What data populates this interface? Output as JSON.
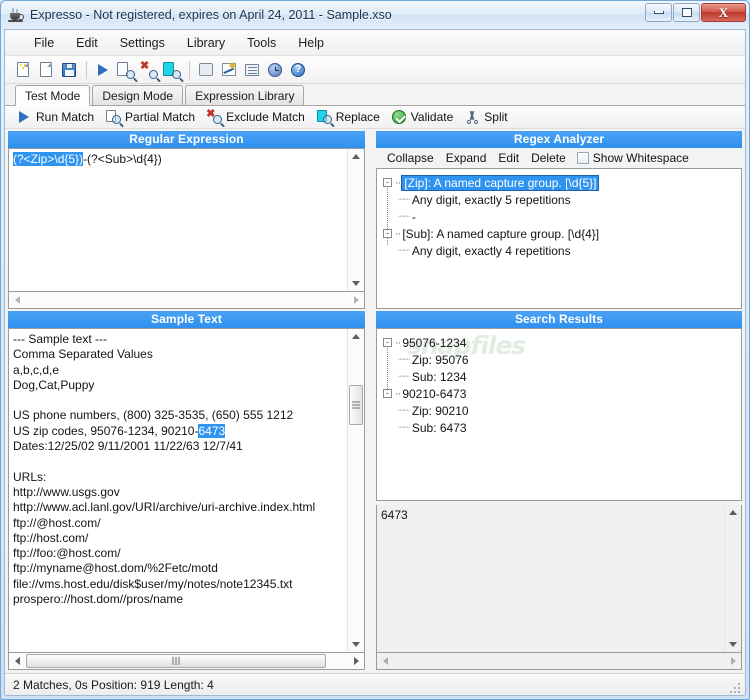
{
  "window": {
    "title": "Expresso - Not registered, expires on April 24, 2011 - Sample.xso",
    "icon": "coffee-cup-icon",
    "minimize_label": "–",
    "maximize_label": "□",
    "close_label": "X"
  },
  "menubar": {
    "items": [
      {
        "label": "File"
      },
      {
        "label": "Edit"
      },
      {
        "label": "Settings"
      },
      {
        "label": "Library"
      },
      {
        "label": "Tools"
      },
      {
        "label": "Help"
      }
    ]
  },
  "toolbar": {
    "buttons": [
      {
        "name": "new-document-icon"
      },
      {
        "name": "open-document-icon"
      },
      {
        "name": "save-icon"
      },
      {
        "name": "separator"
      },
      {
        "name": "run-match-icon"
      },
      {
        "name": "partial-match-icon"
      },
      {
        "name": "exclude-match-icon"
      },
      {
        "name": "replace-icon"
      },
      {
        "name": "separator"
      },
      {
        "name": "library-book-icon"
      },
      {
        "name": "design-chart-icon"
      },
      {
        "name": "notes-icon"
      },
      {
        "name": "history-clock-icon"
      },
      {
        "name": "help-icon",
        "glyph": "?"
      }
    ]
  },
  "tabs": [
    {
      "label": "Test Mode",
      "active": true
    },
    {
      "label": "Design Mode",
      "active": false
    },
    {
      "label": "Expression Library",
      "active": false
    }
  ],
  "actionbar": {
    "actions": [
      {
        "label": "Run Match",
        "icon": "play-icon"
      },
      {
        "label": "Partial Match",
        "icon": "partial-match-icon"
      },
      {
        "label": "Exclude Match",
        "icon": "exclude-match-icon"
      },
      {
        "label": "Replace",
        "icon": "replace-icon"
      },
      {
        "label": "Validate",
        "icon": "validate-check-icon"
      },
      {
        "label": "Split",
        "icon": "scissors-icon"
      }
    ]
  },
  "regular_expression": {
    "title": "Regular Expression",
    "selected_text": "(?<Zip>\\d{5})",
    "rest_text": "-(?<Sub>\\d{4})"
  },
  "regex_analyzer": {
    "title": "Regex Analyzer",
    "toolbar": [
      {
        "label": "Collapse"
      },
      {
        "label": "Expand"
      },
      {
        "label": "Edit"
      },
      {
        "label": "Delete"
      }
    ],
    "show_whitespace_label": "Show Whitespace",
    "show_whitespace_checked": false,
    "tree": [
      {
        "label": "[Zip]: A named capture group. [\\d{5}]",
        "selected": true,
        "expander": "-",
        "children": [
          {
            "label": "Any digit, exactly 5 repetitions"
          }
        ]
      },
      {
        "label": "-",
        "literal": true,
        "children": []
      },
      {
        "label": "[Sub]: A named capture group. [\\d{4}]",
        "selected": false,
        "expander": "-",
        "children": [
          {
            "label": "Any digit, exactly 4 repetitions"
          }
        ]
      }
    ]
  },
  "sample_text": {
    "title": "Sample Text",
    "lines_before": "--- Sample text ---\nComma Separated Values\na,b,c,d,e\nDog,Cat,Puppy\n\nUS phone numbers, (800) 325-3535, (650) 555 1212\nUS zip codes, 95076-1234, 90210-",
    "highlight": "6473",
    "lines_after": "\nDates:12/25/02 9/11/2001 11/22/63 12/7/41\n\nURLs:\nhttp://www.usgs.gov\nhttp://www.acl.lanl.gov/URI/archive/uri-archive.index.html\nftp://@host.com/\nftp://host.com/\nftp://foo:@host.com/\nftp://myname@host.dom/%2Fetc/motd\nfile://vms.host.edu/disk$user/my/notes/note12345.txt\nprospero://host.dom//pros/name"
  },
  "search_results": {
    "title": "Search Results",
    "watermark": "snapfiles",
    "matches": [
      {
        "label": "95076-1234",
        "groups": [
          {
            "label": "Zip: 95076"
          },
          {
            "label": "Sub: 1234"
          }
        ]
      },
      {
        "label": "90210-6473",
        "groups": [
          {
            "label": "Zip: 90210"
          },
          {
            "label": "Sub: 6473"
          }
        ]
      }
    ]
  },
  "match_detail": {
    "value": "6473"
  },
  "statusbar": {
    "text": "2 Matches, 0s  Position: 919  Length: 4"
  },
  "colors": {
    "panel_header": "#2f90ef",
    "selection": "#2f93f0",
    "titlebar_text": "#16334d",
    "close_button": "#bb3a2c"
  }
}
